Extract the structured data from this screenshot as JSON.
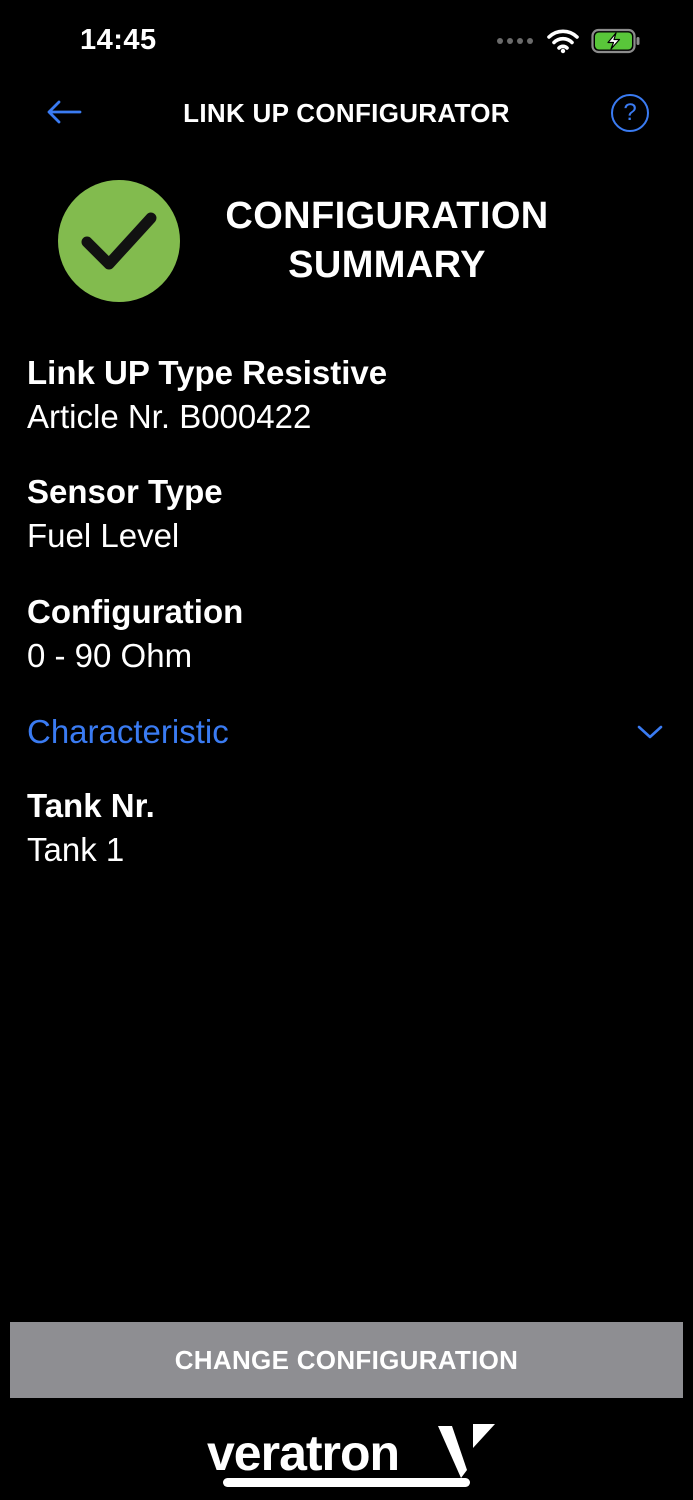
{
  "status_bar": {
    "time": "14:45"
  },
  "nav": {
    "title": "LINK UP CONFIGURATOR",
    "help_glyph": "?"
  },
  "summary": {
    "title_line1": "CONFIGURATION",
    "title_line2": "SUMMARY",
    "accent_color": "#82bb4e"
  },
  "details": {
    "device": {
      "label": "Link UP Type Resistive",
      "value": "Article Nr. B000422"
    },
    "sensor_type": {
      "label": "Sensor Type",
      "value": "Fuel Level"
    },
    "configuration": {
      "label": "Configuration",
      "value": "0 - 90 Ohm"
    },
    "characteristic": {
      "label": "Characteristic",
      "icon": "chevron-down-icon"
    },
    "tank": {
      "label": "Tank Nr.",
      "value": "Tank 1"
    }
  },
  "footer": {
    "button_label": "CHANGE CONFIGURATION",
    "logo_text": "veratron"
  },
  "colors": {
    "link_blue": "#3a7bf2",
    "button_gray": "#8e8e92",
    "battery_green": "#59c63a"
  }
}
